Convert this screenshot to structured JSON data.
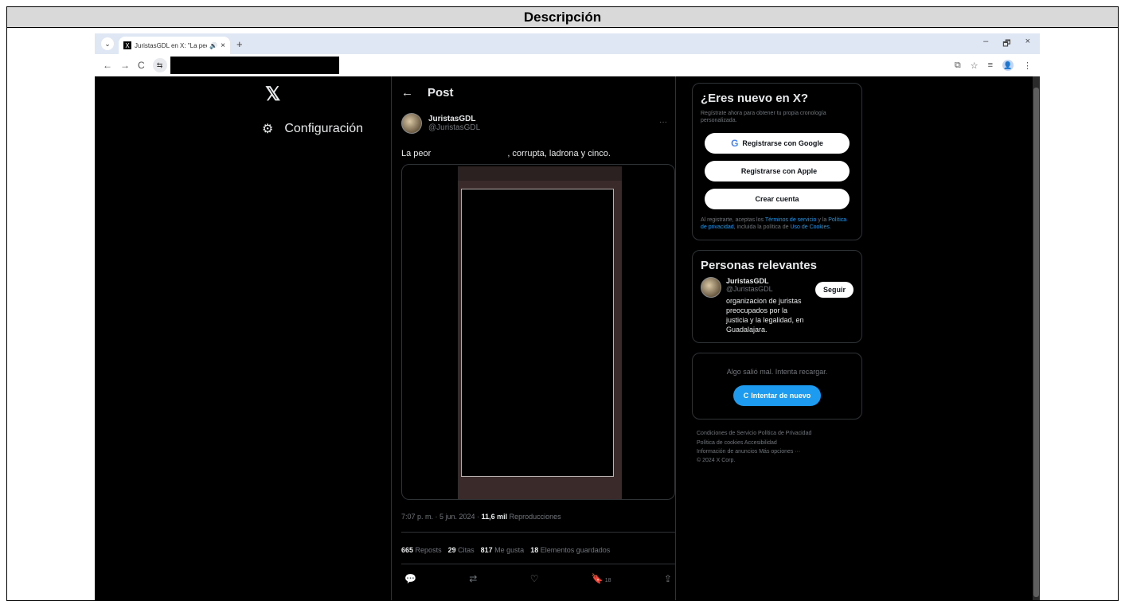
{
  "document": {
    "heading": "Descripción"
  },
  "browser": {
    "tab": {
      "title": "JuristasGDL en X: \"La peor ",
      "favicon": "X",
      "audio_icon": "🔊",
      "close": "×"
    },
    "new_tab": "+",
    "tab_menu": "⌄",
    "window_controls": {
      "minimize": "–",
      "restore": "🗗",
      "close": "×"
    },
    "nav": {
      "back": "←",
      "forward": "→",
      "reload": "C",
      "site_info": "⇆"
    },
    "toolbar_icons": {
      "install": "⧉",
      "bookmark": "☆",
      "reading_list": "≡",
      "profile": "👤",
      "menu": "⋮"
    }
  },
  "sidebar": {
    "logo": "𝕏",
    "settings_icon": "⚙",
    "settings_label": "Configuración"
  },
  "post": {
    "back": "←",
    "title": "Post",
    "author": {
      "display_name": "JuristasGDL",
      "handle": "@JuristasGDL"
    },
    "more": "···",
    "text_start": "La peor",
    "text_end": ", corrupta, ladrona y cinco.",
    "meta": {
      "time": "7:07 p. m. · 5 jun. 2024 · ",
      "views": "11,6 mil",
      "views_label": " Reproducciones"
    },
    "stats": [
      {
        "value": "665",
        "label": "Reposts"
      },
      {
        "value": "29",
        "label": "Citas"
      },
      {
        "value": "817",
        "label": "Me gusta"
      },
      {
        "value": "18",
        "label": "Elementos guardados"
      }
    ],
    "actions": {
      "reply": "💬",
      "repost": "⇄",
      "like": "♡",
      "bookmark": "🔖",
      "bookmark_count": "18",
      "share": "⇪"
    }
  },
  "signup": {
    "title": "¿Eres nuevo en X?",
    "subtitle": "Regístrate ahora para obtener tu propia cronología personalizada.",
    "google_icon": "G",
    "google": "Registrarse con Google",
    "apple_icon": "",
    "apple": "Registrarse con Apple",
    "create": "Crear cuenta",
    "legal_1": "Al registrarte, aceptas los ",
    "terms": "Términos de servicio",
    "legal_2": " y la ",
    "privacy": "Política de privacidad",
    "legal_3": ", incluida la política de ",
    "cookies": "Uso de Cookies",
    "legal_4": "."
  },
  "relevant": {
    "title": "Personas relevantes",
    "display_name": "JuristasGDL",
    "handle": "@JuristasGDL",
    "follow": "Seguir",
    "bio": "organizacion de juristas preocupados por la justicia y la legalidad, en Guadalajara."
  },
  "error": {
    "message": "Algo salió mal. Intenta recargar.",
    "retry_icon": "C",
    "retry": "Intentar de nuevo"
  },
  "footer": {
    "line1": "Condiciones de Servicio   Política de Privacidad",
    "line2": "Política de cookies   Accesibilidad",
    "line3": "Información de anuncios   Más opciones ···",
    "line4": "© 2024 X Corp."
  }
}
